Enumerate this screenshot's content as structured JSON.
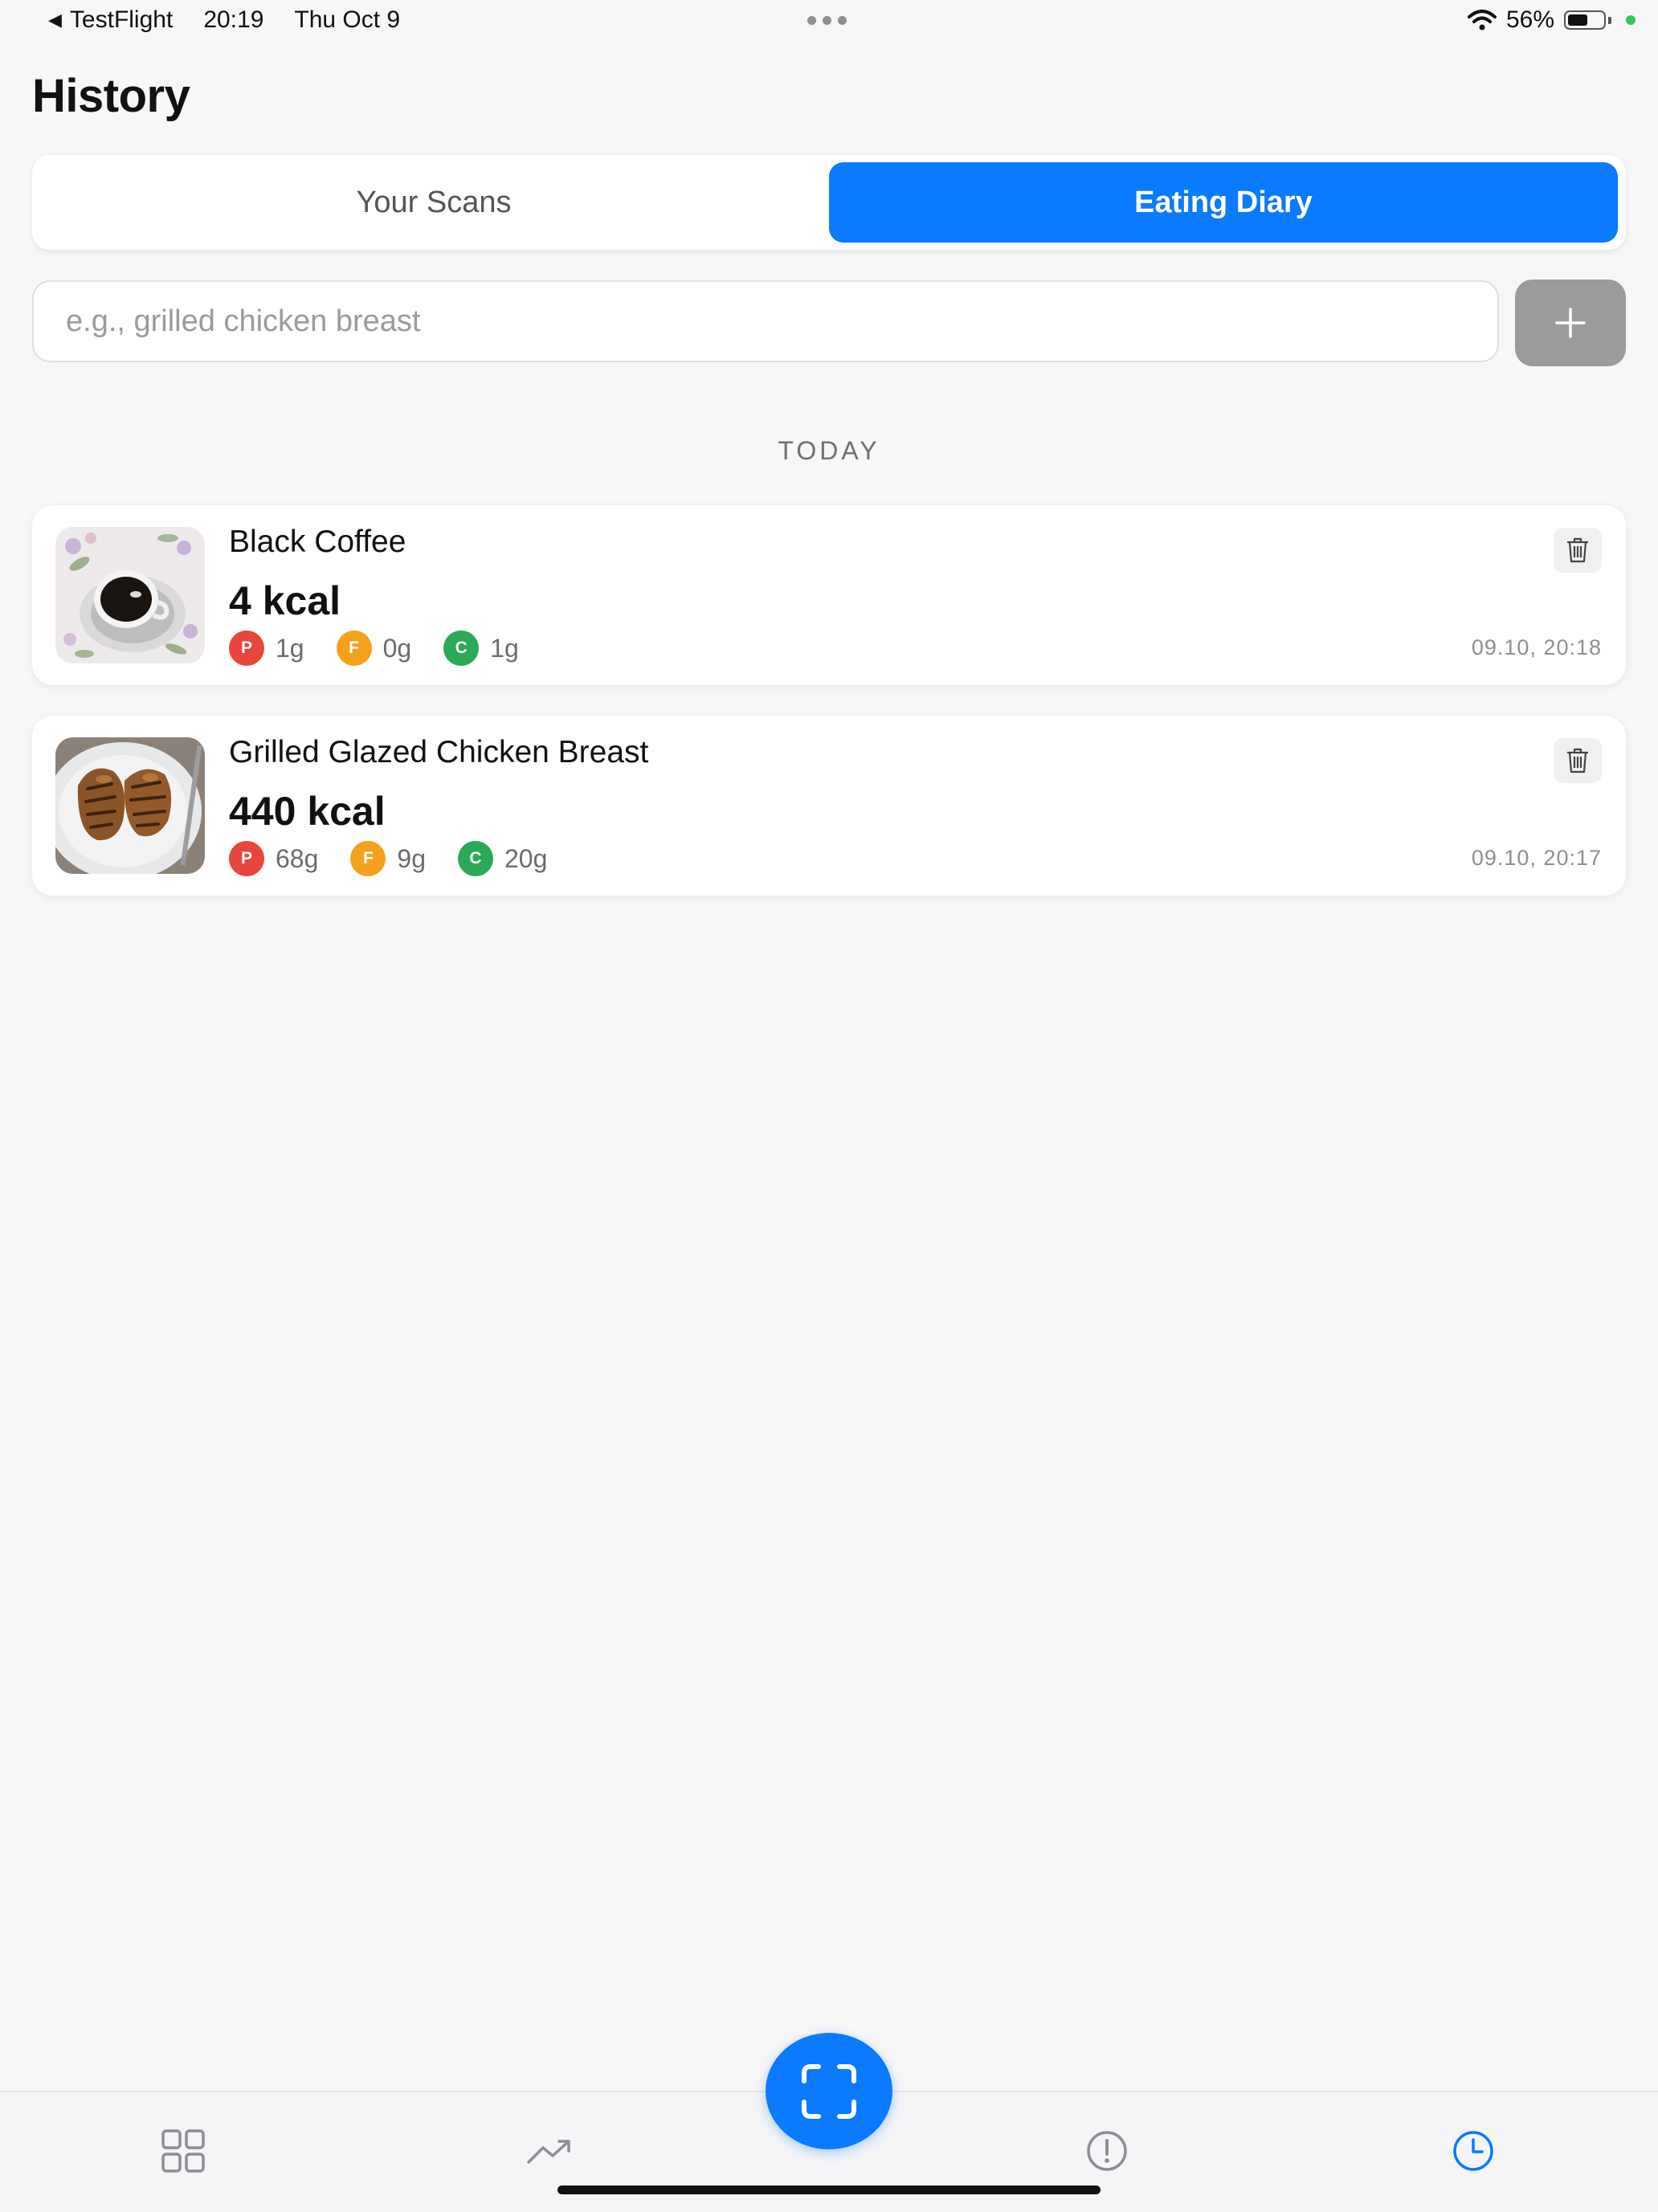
{
  "status_bar": {
    "back_app": "TestFlight",
    "time": "20:19",
    "date": "Thu Oct 9",
    "battery_text": "56%",
    "battery_level": 0.56
  },
  "header": {
    "title": "History"
  },
  "segmented_control": {
    "tabs": [
      {
        "label": "Your Scans",
        "selected": false
      },
      {
        "label": "Eating Diary",
        "selected": true
      }
    ]
  },
  "search": {
    "placeholder": "e.g., grilled chicken breast",
    "value": ""
  },
  "section": {
    "label": "TODAY"
  },
  "entries": [
    {
      "name": "Black Coffee",
      "kcal": "4 kcal",
      "protein_badge": "P",
      "protein": "1g",
      "fat_badge": "F",
      "fat": "0g",
      "carbs_badge": "C",
      "carbs": "1g",
      "time": "09.10, 20:18"
    },
    {
      "name": "Grilled Glazed Chicken Breast",
      "kcal": "440 kcal",
      "protein_badge": "P",
      "protein": "68g",
      "fat_badge": "F",
      "fat": "9g",
      "carbs_badge": "C",
      "carbs": "20g",
      "time": "09.10, 20:17"
    }
  ],
  "tab_bar": {
    "items": [
      "dashboard-grid-icon",
      "trends-icon",
      "info-icon",
      "history-clock-icon"
    ],
    "active": "history-clock-icon",
    "center": "scan-icon"
  },
  "colors": {
    "accent": "#0a7aff",
    "protein": "#e8453c",
    "fat": "#f5a11c",
    "carbs": "#2aa957",
    "add_button": "#9b9b9d"
  }
}
